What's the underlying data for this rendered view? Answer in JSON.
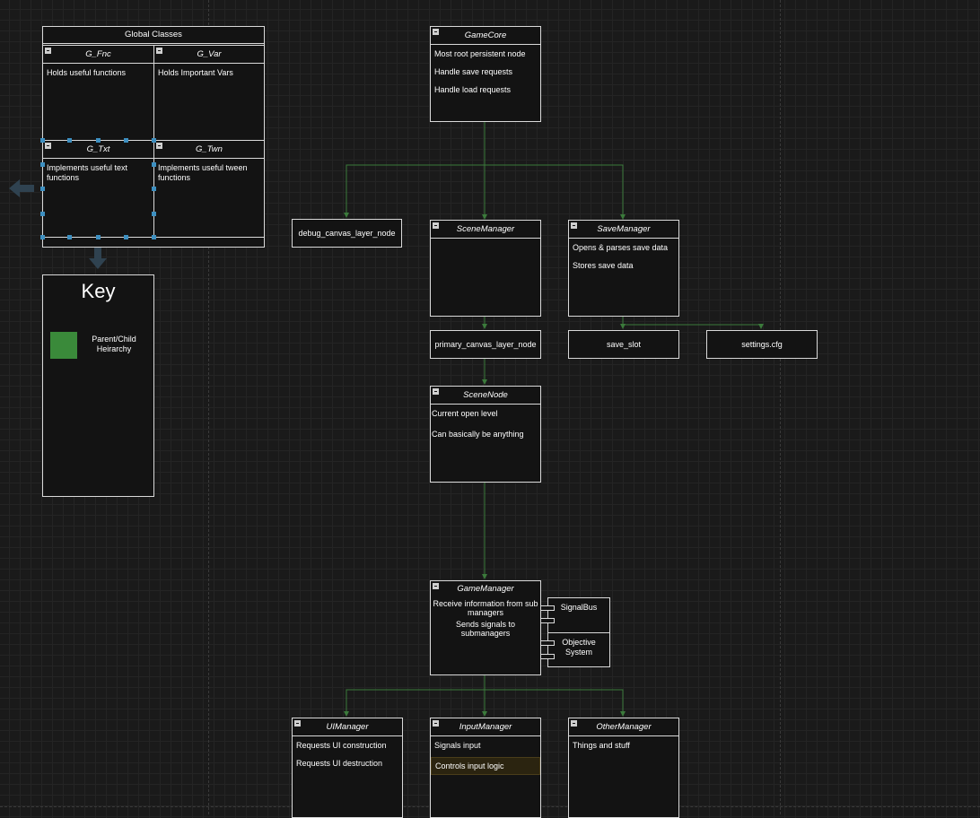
{
  "global_classes": {
    "title": "Global Classes",
    "cells": [
      {
        "title": "G_Fnc",
        "text": "Holds useful functions"
      },
      {
        "title": "G_Var",
        "text": "Holds Important Vars"
      },
      {
        "title": "G_Txt",
        "text": "Implements useful text functions"
      },
      {
        "title": "G_Twn",
        "text": "Implements useful tween functions"
      }
    ]
  },
  "key": {
    "title": "Key",
    "entries": [
      {
        "label": "Parent/Child Heirarchy",
        "color": "#3a8a3a"
      }
    ]
  },
  "nodes": {
    "game_core": {
      "title": "GameCore",
      "lines": [
        "Most root persistent node",
        "Handle save requests",
        "Handle load requests"
      ]
    },
    "debug_canvas": {
      "label": "debug_canvas_layer_node"
    },
    "scene_manager": {
      "title": "SceneManager",
      "lines": []
    },
    "save_manager": {
      "title": "SaveManager",
      "lines": [
        "Opens & parses save data",
        "Stores save data"
      ]
    },
    "primary_canvas": {
      "label": "primary_canvas_layer_node"
    },
    "save_slot": {
      "label": "save_slot"
    },
    "settings": {
      "label": "settings.cfg"
    },
    "scene_node": {
      "title": "SceneNode",
      "lines": [
        "Current open level",
        "Can basically be anything"
      ]
    },
    "game_manager": {
      "title": "GameManager",
      "lines": [
        "Receive information from sub managers",
        "Sends signals to submanagers"
      ]
    },
    "signal_bus": {
      "label": "SignalBus"
    },
    "objective_system": {
      "label": "Objective System"
    },
    "ui_manager": {
      "title": "UIManager",
      "lines": [
        "Requests UI construction",
        "Requests UI destruction"
      ]
    },
    "input_manager": {
      "title": "InputManager",
      "lines": [
        "Signals input",
        "Controls input logic"
      ]
    },
    "other_manager": {
      "title": "OtherManager",
      "lines": [
        "Things and stuff"
      ]
    }
  },
  "colors": {
    "edge": "#3b7a3b",
    "border": "#d9d9d9",
    "selection": "#3d8fc0",
    "highlight": "#2b2410"
  }
}
